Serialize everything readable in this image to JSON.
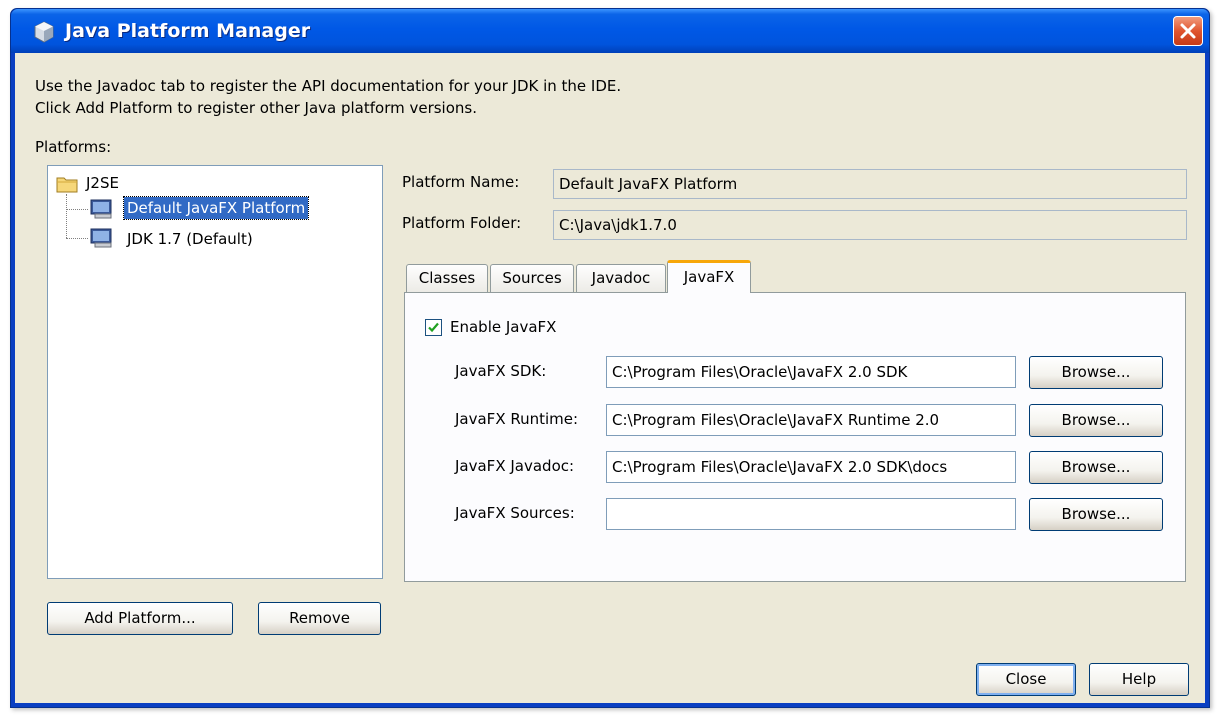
{
  "window": {
    "title": "Java Platform Manager"
  },
  "intro": {
    "line1": "Use the Javadoc tab to register the API documentation for your JDK in the IDE.",
    "line2": "Click Add Platform to register other Java platform versions."
  },
  "platforms": {
    "label": "Platforms:",
    "root": "J2SE",
    "items": [
      "Default JavaFX Platform",
      "JDK 1.7 (Default)"
    ]
  },
  "platform_name": {
    "label": "Platform Name:",
    "value": "Default JavaFX Platform"
  },
  "platform_folder": {
    "label": "Platform Folder:",
    "value": "C:\\Java\\jdk1.7.0"
  },
  "tabs": [
    "Classes",
    "Sources",
    "Javadoc",
    "JavaFX"
  ],
  "javafx": {
    "enable_label": "Enable JavaFX",
    "enabled": true,
    "rows": [
      {
        "label": "JavaFX SDK:",
        "value": "C:\\Program Files\\Oracle\\JavaFX 2.0 SDK",
        "button": "Browse..."
      },
      {
        "label": "JavaFX Runtime:",
        "value": "C:\\Program Files\\Oracle\\JavaFX Runtime 2.0",
        "button": "Browse..."
      },
      {
        "label": "JavaFX Javadoc:",
        "value": "C:\\Program Files\\Oracle\\JavaFX 2.0 SDK\\docs",
        "button": "Browse..."
      },
      {
        "label": "JavaFX Sources:",
        "value": "",
        "button": "Browse..."
      }
    ]
  },
  "buttons": {
    "add_platform": "Add Platform...",
    "remove": "Remove",
    "close": "Close",
    "help": "Help"
  }
}
